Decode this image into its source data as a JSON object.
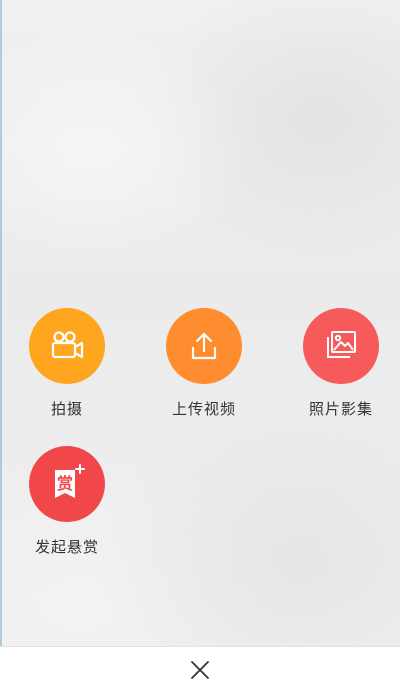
{
  "menu": {
    "items": [
      {
        "label": "拍摄",
        "icon": "video-camera-icon",
        "color": "#FFA51E"
      },
      {
        "label": "上传视频",
        "icon": "upload-icon",
        "color": "#FF8C2E"
      },
      {
        "label": "照片影集",
        "icon": "photo-album-icon",
        "color": "#F75A5A"
      },
      {
        "label": "发起悬赏",
        "icon": "reward-icon",
        "color": "#F2474A",
        "icon_text": "赏"
      }
    ]
  },
  "close": {
    "icon": "close-icon"
  }
}
